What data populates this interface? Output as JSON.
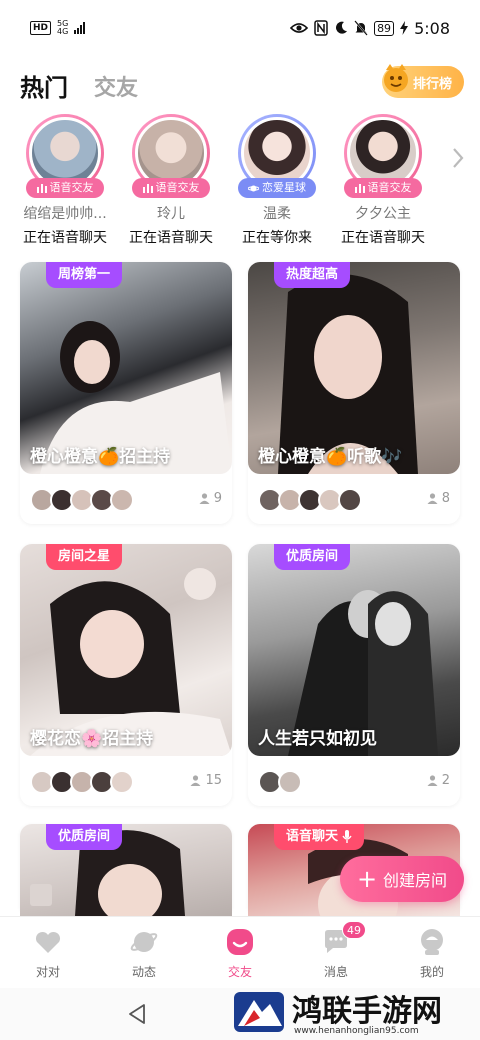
{
  "status_bar": {
    "hd": "HD",
    "net_top": "5G",
    "net_bottom": "4G",
    "battery": "89",
    "time": "5:08"
  },
  "header": {
    "tab_hot": "热门",
    "tab_friend": "交友",
    "rank_label": "排行榜"
  },
  "featured": [
    {
      "badge": "语音交友",
      "name": "绾绾是帅帅...",
      "status": "正在语音聊天",
      "badge_color": "#f56aa0",
      "ring": "#f48fb1",
      "photo": "#9fb4c8"
    },
    {
      "badge": "语音交友",
      "name": "玲儿",
      "status": "正在语音聊天",
      "badge_color": "#f56aa0",
      "ring": "#f48fb1",
      "photo": "#d7c4bb"
    },
    {
      "badge": "恋爱星球",
      "name": "温柔",
      "status": "正在等你来",
      "badge_color": "#7b8cf5",
      "ring": "#9fa8ff",
      "photo": "#e6ccc4"
    },
    {
      "badge": "语音交友",
      "name": "夕夕公主",
      "status": "正在语音聊天",
      "badge_color": "#f56aa0",
      "ring": "#f48fb1",
      "photo": "#cfc2bd"
    }
  ],
  "rooms": [
    {
      "tag": "周榜第一",
      "tag_color": "#a64dff",
      "title": "橙心橙意🍊招主持",
      "count": "9",
      "avatars": 5
    },
    {
      "tag": "热度超高",
      "tag_color": "#a64dff",
      "title": "橙心橙意🍊听歌🎶",
      "count": "8",
      "avatars": 5
    },
    {
      "tag": "房间之星",
      "tag_color": "#ff4d6d",
      "title": "樱花恋🌸招主持",
      "count": "15",
      "avatars": 5
    },
    {
      "tag": "优质房间",
      "tag_color": "#a64dff",
      "title": "人生若只如初见",
      "count": "2",
      "avatars": 2
    },
    {
      "tag": "优质房间",
      "tag_color": "#a64dff",
      "title": "",
      "count": "",
      "avatars": 0
    },
    {
      "tag": "语音聊天",
      "tag_color": "#ff4d6d",
      "title": "",
      "count": "",
      "avatars": 0
    }
  ],
  "fab": {
    "label": "创建房间"
  },
  "nav": {
    "items": [
      {
        "label": "对对"
      },
      {
        "label": "动态"
      },
      {
        "label": "交友"
      },
      {
        "label": "消息",
        "badge": "49"
      },
      {
        "label": "我的"
      }
    ]
  },
  "watermark": {
    "text": "鸿联手游网",
    "url": "www.henanhonglian95.com"
  }
}
